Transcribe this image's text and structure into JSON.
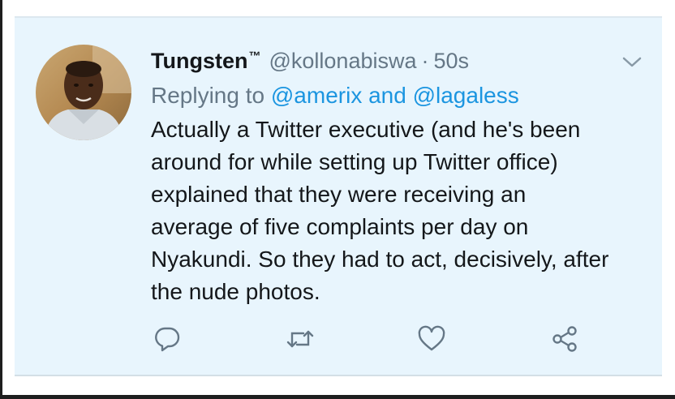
{
  "tweet": {
    "display_name": "Tungsten",
    "trademark": "™",
    "handle": "@kollonabiswa",
    "separator": "·",
    "time": "50s",
    "replying_prefix": "Replying to",
    "reply_mention_1": "@amerix",
    "reply_conjunction": "and",
    "reply_mention_2": "@lagaless",
    "text_lines": [
      "Actually a Twitter executive (and he's been",
      "around for while setting up Twitter office)",
      "explained that they were receiving an",
      "average of five complaints per day on",
      "Nyakundi. So they had to act, decisively, after",
      "the nude photos."
    ]
  },
  "icons": {
    "menu": "chevron-down-icon",
    "reply": "reply-icon",
    "retweet": "retweet-icon",
    "like": "heart-icon",
    "share": "share-icon"
  },
  "colors": {
    "card_background": "#e8f5fd",
    "mention": "#1b95e0",
    "secondary_text": "#657786",
    "primary_text": "#14171a"
  }
}
